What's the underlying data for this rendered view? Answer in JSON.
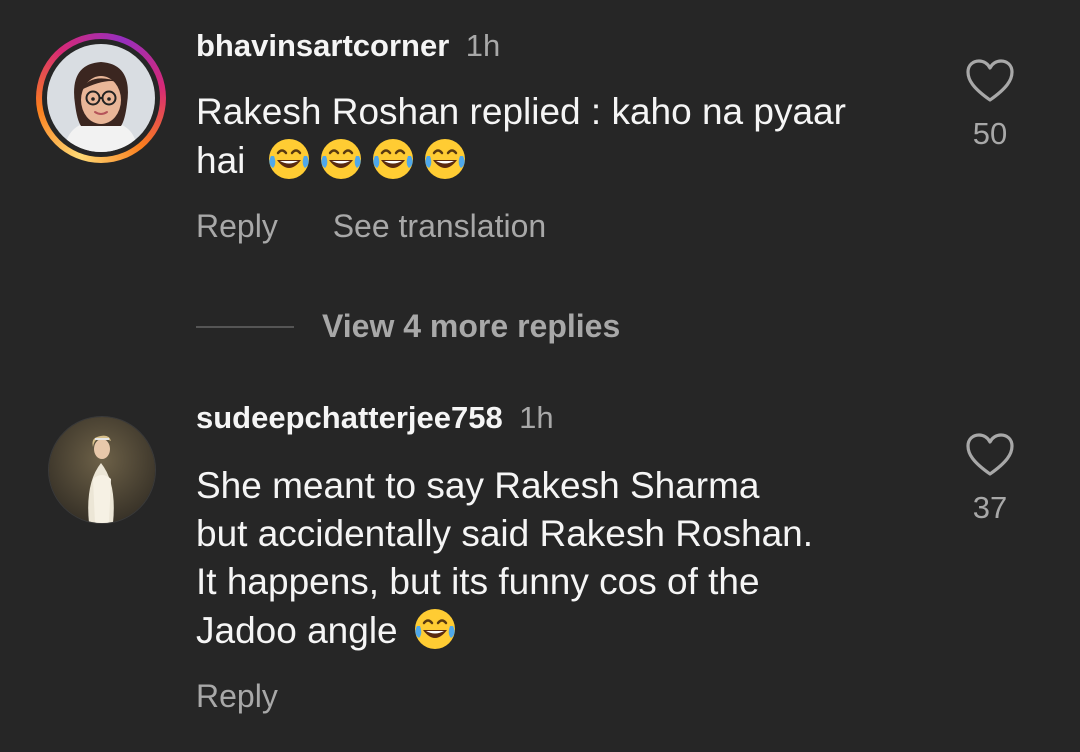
{
  "comments": [
    {
      "username": "bhavinsartcorner",
      "time": "1h",
      "line1": "Rakesh Roshan replied : kaho na pyaar",
      "line2": "hai",
      "likes": "50",
      "reply_label": "Reply",
      "translate_label": "See translation",
      "has_story_ring": true,
      "emoji": "face-with-tears-of-joy",
      "emoji_count": 4
    },
    {
      "username": "sudeepchatterjee758",
      "time": "1h",
      "line1": "She meant to say Rakesh Sharma",
      "line2": "but accidentally said Rakesh Roshan.",
      "line3": "It happens, but its funny cos of the",
      "line4": "Jadoo angle",
      "likes": "37",
      "reply_label": "Reply",
      "has_story_ring": false,
      "emoji": "face-with-tears-of-joy",
      "emoji_count": 1
    }
  ],
  "view_replies_label": "View 4 more replies",
  "colors": {
    "background": "#262626",
    "primary_text": "#f5f5f5",
    "secondary_text": "#a8a8a8"
  }
}
